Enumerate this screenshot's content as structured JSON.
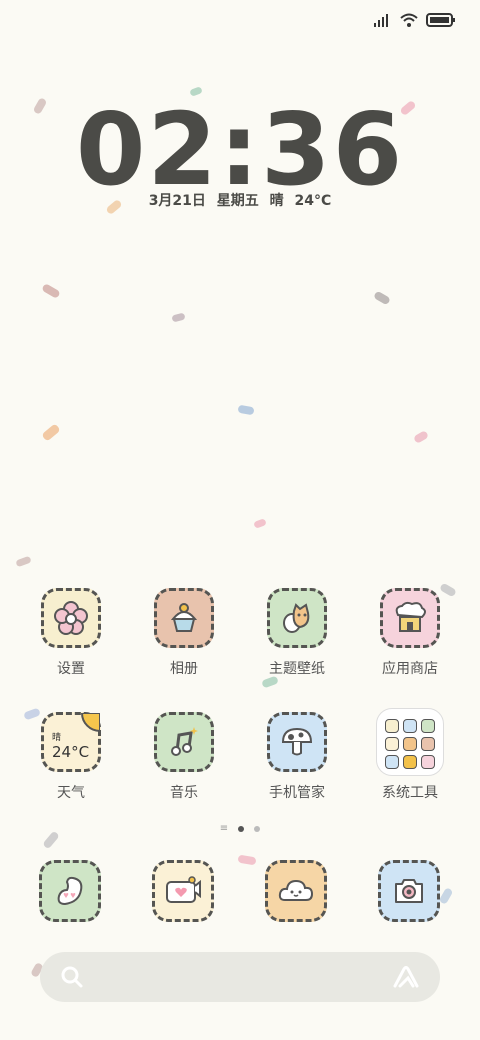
{
  "clock": {
    "time": "02:36",
    "date": "3月21日 星期五 晴 24°C"
  },
  "apps": [
    {
      "label": "设置",
      "icon": "flower-icon",
      "color": "#f7efcf"
    },
    {
      "label": "相册",
      "icon": "cupcake-icon",
      "color": "#e8c3ad"
    },
    {
      "label": "主题壁纸",
      "icon": "cat-icon",
      "color": "#cfe5c6"
    },
    {
      "label": "应用商店",
      "icon": "shop-icon",
      "color": "#f6d3dc"
    },
    {
      "label": "天气",
      "icon": "sun-icon",
      "color": "#fbf1d6",
      "weather": "晴",
      "temp": "24°C"
    },
    {
      "label": "音乐",
      "icon": "music-note-icon",
      "color": "#cfe5c6"
    },
    {
      "label": "手机管家",
      "icon": "mushroom-icon",
      "color": "#cfe4f5"
    },
    {
      "label": "系统工具",
      "icon": "tools-folder-icon",
      "color": "#ffffff"
    }
  ],
  "dock": [
    {
      "icon": "phone-bean-icon",
      "color": "#cfe5c6"
    },
    {
      "icon": "message-icon",
      "color": "#fbf1d6"
    },
    {
      "icon": "cloud-face-icon",
      "color": "#f6d6a6"
    },
    {
      "icon": "camera-icon",
      "color": "#cfe4f5"
    }
  ],
  "pager": {
    "pages": 2,
    "active": 0
  },
  "search": {
    "left_icon": "search-icon",
    "right_icon": "assistant-icon"
  },
  "status": {
    "signal": "signal-icon",
    "wifi": "wifi-icon",
    "battery": "battery-icon"
  }
}
